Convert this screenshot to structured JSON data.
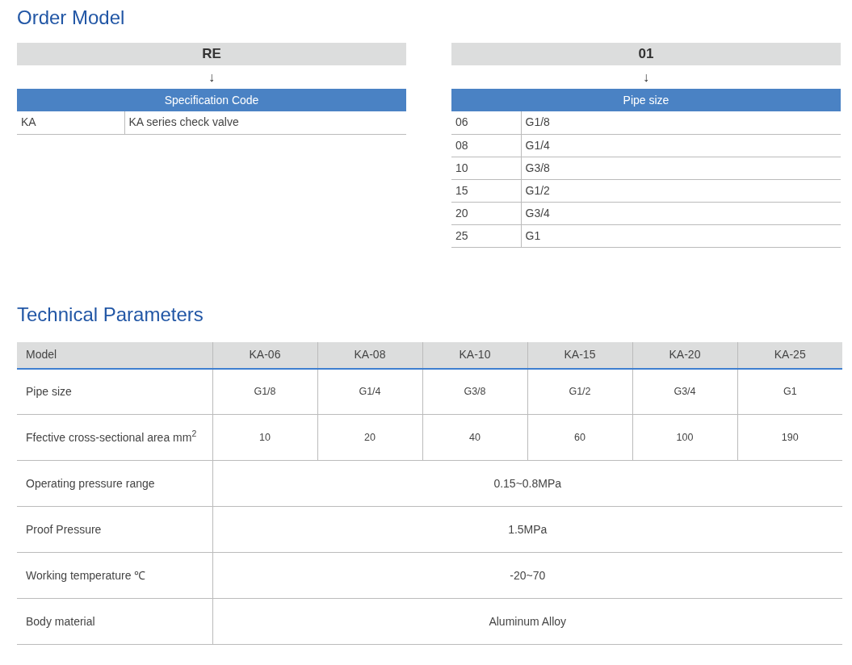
{
  "order_model": {
    "title": "Order Model",
    "blocks": [
      {
        "code": "RE",
        "arrow": "↓",
        "header": "Specification Code",
        "rows": [
          [
            "KA",
            "KA series check valve"
          ]
        ]
      },
      {
        "code": "01",
        "arrow": "↓",
        "header": "Pipe size",
        "rows": [
          [
            "06",
            "G1/8"
          ],
          [
            "08",
            "G1/4"
          ],
          [
            "10",
            "G3/8"
          ],
          [
            "15",
            "G1/2"
          ],
          [
            "20",
            "G3/4"
          ],
          [
            "25",
            "G1"
          ]
        ]
      }
    ]
  },
  "technical_parameters": {
    "title": "Technical Parameters",
    "columns": [
      "Model",
      "KA-06",
      "KA-08",
      "KA-10",
      "KA-15",
      "KA-20",
      "KA-25"
    ],
    "rows": [
      {
        "label": "Pipe size",
        "values": [
          "G1/8",
          "G1/4",
          "G3/8",
          "G1/2",
          "G3/4",
          "G1"
        ]
      },
      {
        "label": "Ffective cross-sectional area mm$^{2}$",
        "values": [
          "10",
          "20",
          "40",
          "60",
          "100",
          "190"
        ]
      },
      {
        "label": "Operating pressure range",
        "values": [
          "0.15~0.8MPa"
        ]
      },
      {
        "label": "Proof Pressure",
        "values": [
          "1.5MPa"
        ]
      },
      {
        "label": "Working temperature ℃",
        "values": [
          "-20~70"
        ]
      },
      {
        "label": "Body material",
        "values": [
          "Aluminum Alloy"
        ]
      }
    ]
  }
}
